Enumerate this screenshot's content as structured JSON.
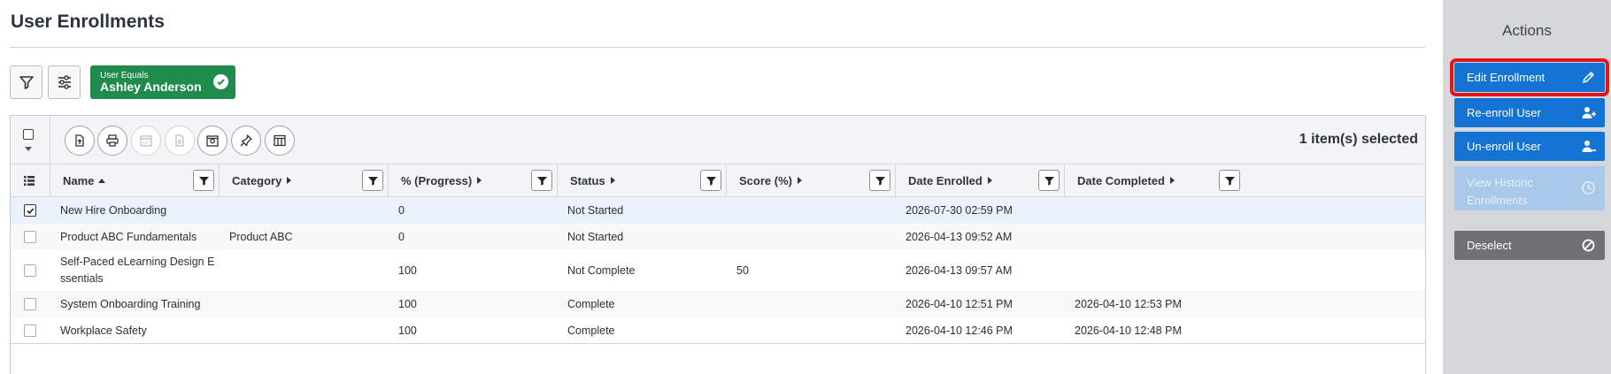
{
  "page": {
    "title": "User Enrollments"
  },
  "toolbar": {
    "filter_button_icon": "funnel-icon",
    "settings_button_icon": "sliders-icon",
    "filter_chip": {
      "condition": "User Equals",
      "value": "Ashley Anderson",
      "icon": "check-circle-icon",
      "color": "#1f8b4c"
    }
  },
  "grid": {
    "selection_text": "1 item(s) selected",
    "toolbar_icons": [
      "export-icon",
      "print-icon",
      "calendar-icon",
      "document-icon",
      "certificate-icon",
      "pin-icon",
      "columns-icon"
    ],
    "columns": [
      {
        "label": "Name",
        "sort": "ascending"
      },
      {
        "label": "Category"
      },
      {
        "label": "% (Progress)"
      },
      {
        "label": "Status"
      },
      {
        "label": "Score (%)"
      },
      {
        "label": "Date Enrolled"
      },
      {
        "label": "Date Completed"
      }
    ],
    "rows": [
      {
        "selected": true,
        "name": "New Hire Onboarding",
        "category": "",
        "progress": "0",
        "status": "Not Started",
        "score": "",
        "date_enrolled": "2026-07-30 02:59 PM",
        "date_completed": ""
      },
      {
        "selected": false,
        "name": "Product ABC Fundamentals",
        "category": "Product ABC",
        "progress": "0",
        "status": "Not Started",
        "score": "",
        "date_enrolled": "2026-04-13 09:52 AM",
        "date_completed": ""
      },
      {
        "selected": false,
        "name_line1": "Self-Paced eLearning Design E",
        "name_line2": "ssentials",
        "category": "",
        "progress": "100",
        "status": "Not Complete",
        "score": "50",
        "date_enrolled": "2026-04-13 09:57 AM",
        "date_completed": ""
      },
      {
        "selected": false,
        "name": "System Onboarding Training",
        "category": "",
        "progress": "100",
        "status": "Complete",
        "score": "",
        "date_enrolled": "2026-04-10 12:51 PM",
        "date_completed": "2026-04-10 12:53 PM"
      },
      {
        "selected": false,
        "name": "Workplace Safety",
        "category": "",
        "progress": "100",
        "status": "Complete",
        "score": "",
        "date_enrolled": "2026-04-10 12:46 PM",
        "date_completed": "2026-04-10 12:48 PM"
      }
    ]
  },
  "actions": {
    "title": "Actions",
    "edit": {
      "label": "Edit Enrollment",
      "icon": "pencil-icon",
      "highlighted": true
    },
    "reenroll": {
      "label": "Re-enroll User",
      "icon": "user-add-icon"
    },
    "unenroll": {
      "label": "Un-enroll User",
      "icon": "user-remove-icon"
    },
    "historic": {
      "label_line1": "View Historic",
      "label_line2": "Enrollments",
      "icon": "clock-icon",
      "disabled": true
    },
    "deselect": {
      "label": "Deselect",
      "icon": "block-icon"
    }
  },
  "colors": {
    "primary": "#1474d4",
    "disabled": "#a9c8ea",
    "deselect": "#6e7277",
    "highlight": "#e0161c",
    "selected_row": "#e9f2fb",
    "alt_row": "#f8f8f9"
  }
}
